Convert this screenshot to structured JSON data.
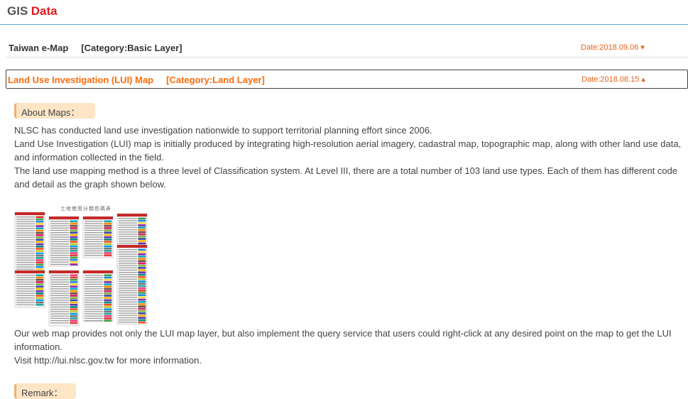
{
  "header": {
    "title_part1": "GIS",
    "title_part2": "Data"
  },
  "layers": [
    {
      "title": "Taiwan e-Map",
      "category": "[Category:Basic Layer]",
      "date": "Date:2018.09.06 ▾"
    },
    {
      "title": "Land Use Investigation (LUI) Map",
      "category": "[Category:Land Layer]",
      "date": "Date:2018.08.15 ▴"
    }
  ],
  "about": {
    "label": "About Maps：",
    "paragraphs": [
      "NLSC has conducted land use investigation nationwide to support territorial planning effort since 2006.",
      "Land Use Investigation (LUI) map is initially produced by integrating high-resolution aerial imagery, cadastral map, topographic map, along with other land use data, and information collected in the field.",
      "The land use mapping method is a three level of Classification system. At Level III, there are a total number of 103 land use types. Each of them has different code and detail as the graph shown below."
    ],
    "figure_caption": "土地使用分類色碼表",
    "paragraphs_after": [
      "Our web map provides not only the LUI map layer, but also implement the query service that users could right-click at any desired point on the map to get the LUI information.",
      "Visit http://lui.nlsc.gov.tw for more information."
    ]
  },
  "remark": {
    "label": "Remark："
  },
  "colors": {
    "accent_orange": "#ff6a0a",
    "title_red": "#e01c1c",
    "rule_blue": "#5aa8d8",
    "label_bg": "#fde5c6"
  }
}
